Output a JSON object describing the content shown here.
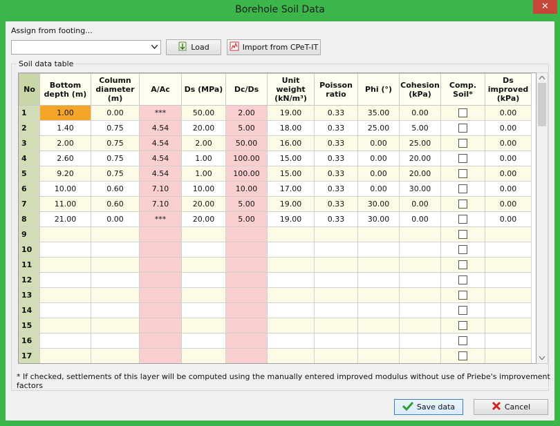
{
  "window": {
    "title": "Borehole Soil Data",
    "close_glyph": "✕"
  },
  "assign": {
    "label": "Assign from footing...",
    "combo_value": ""
  },
  "buttons": {
    "load": "Load",
    "import": "Import from CPeT-IT",
    "save": "Save data",
    "cancel": "Cancel"
  },
  "group": {
    "label": "Soil data table"
  },
  "table": {
    "headers": [
      "No",
      "Bottom depth (m)",
      "Column diameter (m)",
      "A/Ac",
      "Ds (MPa)",
      "Dc/Ds",
      "Unit weight (kN/m³)",
      "Poisson ratio",
      "Phi (°)",
      "Cohesion (kPa)",
      "Comp. Soil*",
      "Ds improved (kPa)"
    ],
    "rows": [
      [
        "1",
        "1.00",
        "0.00",
        "***",
        "50.00",
        "2.00",
        "19.00",
        "0.33",
        "35.00",
        "0.00",
        "0.00"
      ],
      [
        "2",
        "1.40",
        "0.75",
        "4.54",
        "20.00",
        "5.00",
        "18.00",
        "0.33",
        "25.00",
        "5.00",
        "0.00"
      ],
      [
        "3",
        "2.00",
        "0.75",
        "4.54",
        "2.00",
        "50.00",
        "16.00",
        "0.33",
        "0.00",
        "25.00",
        "0.00"
      ],
      [
        "4",
        "2.60",
        "0.75",
        "4.54",
        "1.00",
        "100.00",
        "15.00",
        "0.33",
        "0.00",
        "20.00",
        "0.00"
      ],
      [
        "5",
        "9.20",
        "0.75",
        "4.54",
        "1.00",
        "100.00",
        "15.00",
        "0.33",
        "0.00",
        "20.00",
        "0.00"
      ],
      [
        "6",
        "10.00",
        "0.60",
        "7.10",
        "10.00",
        "10.00",
        "17.00",
        "0.33",
        "0.00",
        "30.00",
        "0.00"
      ],
      [
        "7",
        "11.00",
        "0.60",
        "7.10",
        "20.00",
        "5.00",
        "19.00",
        "0.33",
        "30.00",
        "0.00",
        "0.00"
      ],
      [
        "8",
        "21.00",
        "0.00",
        "***",
        "20.00",
        "5.00",
        "19.00",
        "0.33",
        "30.00",
        "0.00",
        "0.00"
      ],
      [
        "9",
        "",
        "",
        "",
        "",
        "",
        "",
        "",
        "",
        "",
        ""
      ],
      [
        "10",
        "",
        "",
        "",
        "",
        "",
        "",
        "",
        "",
        "",
        ""
      ],
      [
        "11",
        "",
        "",
        "",
        "",
        "",
        "",
        "",
        "",
        "",
        ""
      ],
      [
        "12",
        "",
        "",
        "",
        "",
        "",
        "",
        "",
        "",
        "",
        ""
      ],
      [
        "13",
        "",
        "",
        "",
        "",
        "",
        "",
        "",
        "",
        "",
        ""
      ],
      [
        "14",
        "",
        "",
        "",
        "",
        "",
        "",
        "",
        "",
        "",
        ""
      ],
      [
        "15",
        "",
        "",
        "",
        "",
        "",
        "",
        "",
        "",
        "",
        ""
      ],
      [
        "16",
        "",
        "",
        "",
        "",
        "",
        "",
        "",
        "",
        "",
        ""
      ],
      [
        "17",
        "",
        "",
        "",
        "",
        "",
        "",
        "",
        "",
        "",
        ""
      ]
    ]
  },
  "footnote": "* If checked, settlements of this layer will be computed using the manually entered improved modulus without use of Priebe's improvement factors",
  "colors": {
    "frame": "#3cb64a",
    "selected_cell": "#f5a627",
    "pink_column": "#f9cfd0",
    "row_header": "#d2ddb6"
  },
  "icons": {
    "close": "close-icon",
    "load": "load-icon",
    "import": "import-icon",
    "save": "checkmark-icon",
    "cancel": "cross-icon",
    "dropdown": "chevron-down-icon"
  }
}
